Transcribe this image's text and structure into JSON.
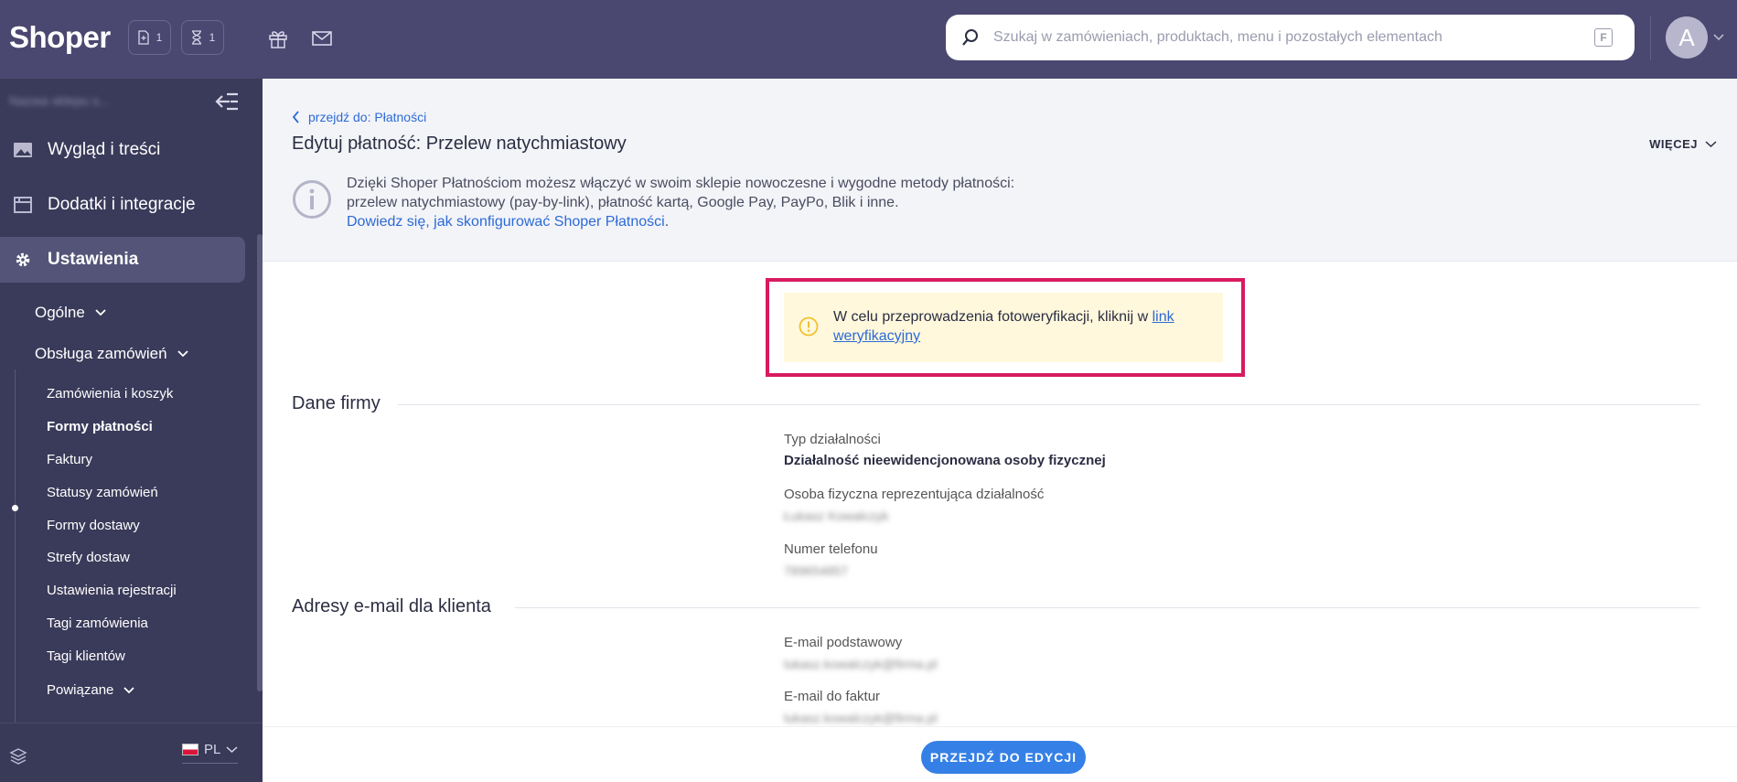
{
  "app": {
    "logo": "Shoper",
    "chip_orders_count": "1",
    "chip_pending_count": "1",
    "search_placeholder": "Szukaj w zamówieniach, produktach, menu i pozostałych elementach",
    "search_shortcut": "F",
    "avatar_letter": "A"
  },
  "sidebar": {
    "shop_name": "Nazwa sklepu s...",
    "items": [
      {
        "label": "Wygląd i treści",
        "icon": "image-icon"
      },
      {
        "label": "Dodatki i integracje",
        "icon": "window-icon"
      },
      {
        "label": "Ustawienia",
        "icon": "gear-icon"
      }
    ],
    "groups": [
      {
        "label": "Ogólne"
      },
      {
        "label": "Obsługa zamówień"
      }
    ],
    "sub_items": [
      "Zamówienia i koszyk",
      "Formy płatności",
      "Faktury",
      "Statusy zamówień",
      "Formy dostawy",
      "Strefy dostaw",
      "Ustawienia rejestracji",
      "Tagi zamówienia",
      "Tagi klientów"
    ],
    "related_label": "Powiązane",
    "language": "PL"
  },
  "page": {
    "breadcrumb": "przejdź do: Płatności",
    "title": "Edytuj płatność: Przelew natychmiastowy",
    "more_label": "WIĘCEJ",
    "info_line1": "Dzięki Shoper Płatnościom możesz włączyć w swoim sklepie nowoczesne i wygodne metody płatności:",
    "info_line2": "przelew natychmiastowy (pay-by-link), płatność kartą, Google Pay, PayPo, Blik i inne.",
    "info_link": "Dowiedz się, jak skonfigurować Shoper Płatności",
    "info_link_suffix": ".",
    "notice_text": "W celu przeprowadzenia fotoweryfikacji, kliknij w ",
    "notice_link": "link weryfikacyjny"
  },
  "sections": {
    "company": {
      "title": "Dane firmy",
      "business_type_label": "Typ działalności",
      "business_type_value": "Działalność nieewidencjonowana osoby fizycznej",
      "person_label": "Osoba fizyczna reprezentująca działalność",
      "person_value": "Łukasz Kowalczyk",
      "phone_label": "Numer telefonu",
      "phone_value": "789654857"
    },
    "emails": {
      "title": "Adresy e-mail dla klienta",
      "primary_label": "E-mail podstawowy",
      "primary_value": "lukasz.kowalczyk@firma.pl",
      "invoice_label": "E-mail do faktur",
      "invoice_value": "lukasz.kowalczyk@firma.pl"
    }
  },
  "actions": {
    "edit_label": "PRZEJDŹ DO EDYCJI"
  },
  "colors": {
    "topbar": "#4a4770",
    "sidebar": "#3a3a5a",
    "accent": "#3580e6",
    "link": "#2c6ad7",
    "highlight": "#d81b60",
    "notice_bg": "#fff8dc"
  }
}
